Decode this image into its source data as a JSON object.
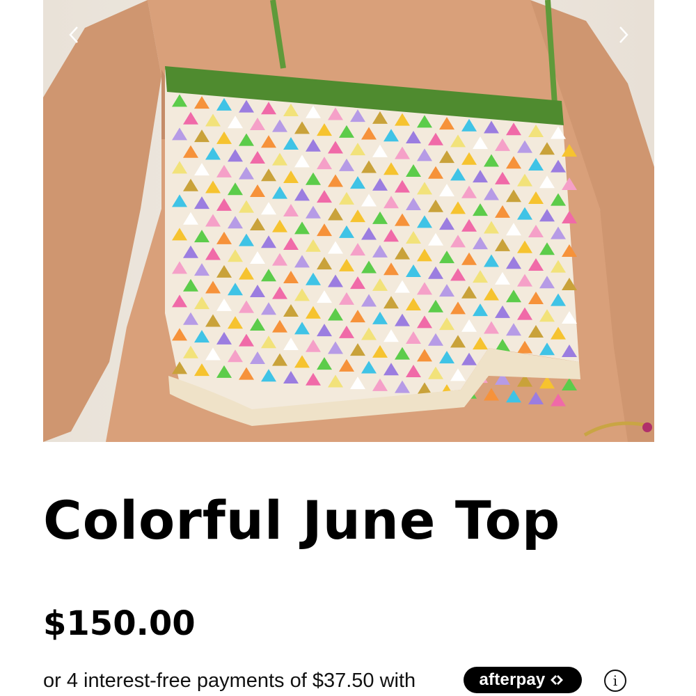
{
  "product": {
    "title": "Colorful June Top",
    "price": "$150.00",
    "image_alt": "Multicolor granny-square crochet crop top"
  },
  "gallery": {
    "prev_icon": "chevron-left-icon",
    "next_icon": "chevron-right-icon"
  },
  "payment": {
    "installment_text": "or 4 interest-free payments of $37.50 with",
    "provider_label": "afterpay",
    "provider_icon": "afterpay-arrows-icon",
    "info_icon": "info-icon",
    "info_symbol": "i"
  },
  "colors": {
    "text": "#000000",
    "badge_bg": "#000000",
    "badge_text": "#ffffff",
    "photo_bg": "#ece5dc",
    "skin": "#d9a07a",
    "strap_green": "#5f9a3a"
  }
}
